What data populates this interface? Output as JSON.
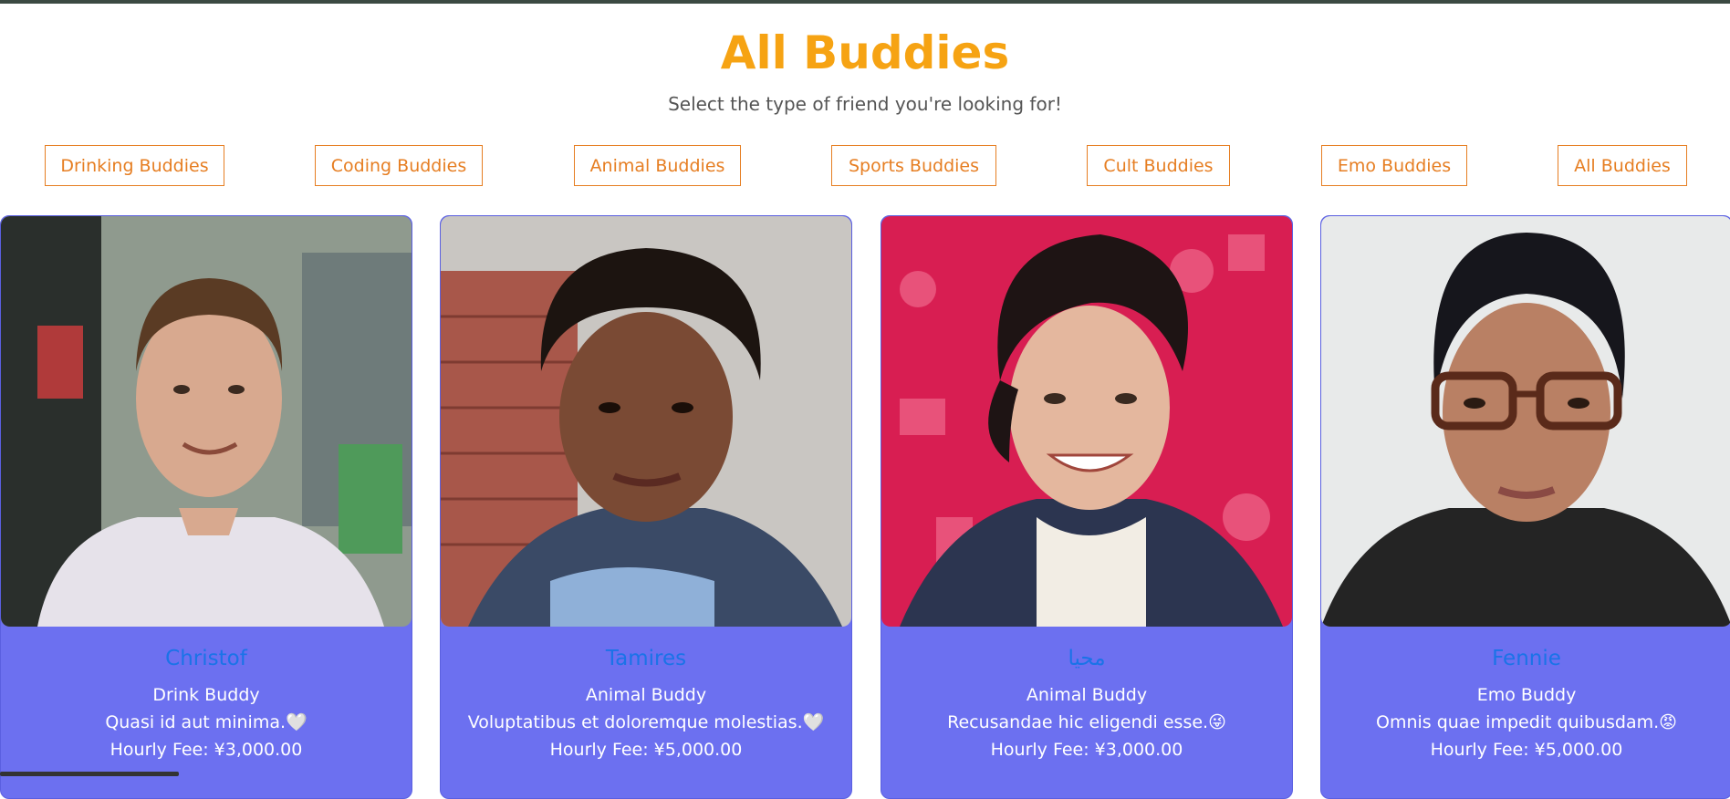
{
  "header": {
    "title": "All Buddies",
    "subtitle": "Select the type of friend you're looking for!"
  },
  "filters": [
    "Drinking Buddies",
    "Coding Buddies",
    "Animal Buddies",
    "Sports Buddies",
    "Cult Buddies",
    "Emo Buddies",
    "All Buddies"
  ],
  "buddies": [
    {
      "name": "Christof",
      "type": "Drink Buddy",
      "description": "Quasi id aut minima.🤍",
      "fee": "Hourly Fee: ¥3,000.00",
      "photo_colors": {
        "bg": "#8f9a8e",
        "skin": "#d8a98f",
        "hair": "#5a3b24",
        "shirt": "#e6e2ea"
      }
    },
    {
      "name": "Tamires",
      "type": "Animal Buddy",
      "description": "Voluptatibus et doloremque molestias.🤍",
      "fee": "Hourly Fee: ¥5,000.00",
      "photo_colors": {
        "bg": "#a8574a",
        "skin": "#7a4a34",
        "hair": "#1c1410",
        "shirt": "#3a4a66"
      }
    },
    {
      "name": "محيا",
      "type": "Animal Buddy",
      "description": "Recusandae hic eligendi esse.😜",
      "fee": "Hourly Fee: ¥3,000.00",
      "photo_colors": {
        "bg": "#d81e52",
        "skin": "#e4b79e",
        "hair": "#1e1414",
        "shirt": "#2c3550"
      }
    },
    {
      "name": "Fennie",
      "type": "Emo Buddy",
      "description": "Omnis quae impedit quibusdam.😡",
      "fee": "Hourly Fee: ¥5,000.00",
      "photo_colors": {
        "bg": "#e8eaea",
        "skin": "#b98064",
        "hair": "#16161c",
        "shirt": "#242424"
      }
    }
  ],
  "colors": {
    "title": "#f6a313",
    "filter_border": "#e67e22",
    "card_bg": "#6c70f0",
    "card_name": "#1a73e8"
  }
}
